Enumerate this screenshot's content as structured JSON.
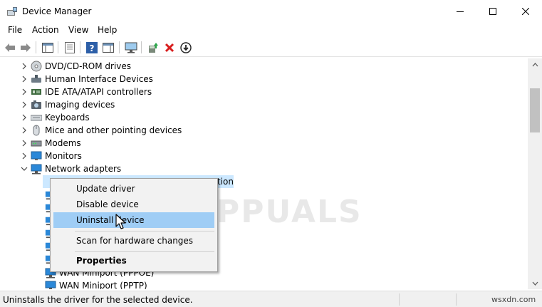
{
  "window": {
    "title": "Device Manager"
  },
  "menu": [
    "File",
    "Action",
    "View",
    "Help"
  ],
  "tree": {
    "items": [
      {
        "label": "DVD/CD-ROM drives",
        "icon": "dvd-drive-icon"
      },
      {
        "label": "Human Interface Devices",
        "icon": "hid-icon"
      },
      {
        "label": "IDE ATA/ATAPI controllers",
        "icon": "ide-controller-icon"
      },
      {
        "label": "Imaging devices",
        "icon": "camera-icon"
      },
      {
        "label": "Keyboards",
        "icon": "keyboard-icon"
      },
      {
        "label": "Mice and other pointing devices",
        "icon": "mouse-icon"
      },
      {
        "label": "Modems",
        "icon": "modem-icon"
      },
      {
        "label": "Monitors",
        "icon": "monitor-icon"
      },
      {
        "label": "Network adapters",
        "icon": "network-adapter-icon",
        "expanded": true
      }
    ],
    "selected_suffix": "tion",
    "children": [
      {
        "label": "WAN Miniport (PPPOE)"
      },
      {
        "label": "WAN Miniport (PPTP)"
      }
    ]
  },
  "context_menu": {
    "items": [
      {
        "label": "Update driver"
      },
      {
        "label": "Disable device"
      },
      {
        "label": "Uninstall device",
        "highlighted": true
      },
      {
        "label": "Scan for hardware changes"
      },
      {
        "label": "Properties",
        "bold": true
      }
    ]
  },
  "watermark": "APPUALS",
  "status": {
    "text": "Uninstalls the driver for the selected device.",
    "site": "wsxdn.com"
  },
  "colors": {
    "selection": "#cce8ff",
    "menu_highlight": "#9fcdf5",
    "network_icon": "#2b88d8"
  }
}
